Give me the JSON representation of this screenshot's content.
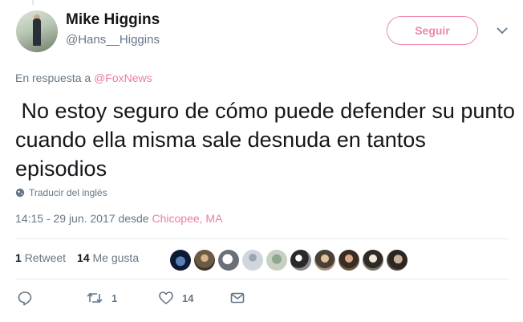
{
  "author": {
    "name": "Mike Higgins",
    "handle": "@Hans__Higgins"
  },
  "follow_button": "Seguir",
  "reply_to": {
    "prefix": "En respuesta a",
    "mention": "@FoxNews"
  },
  "tweet_text": " No estoy seguro de cómo puede defender su punto cuando ella misma sale desnuda en tantos episodios",
  "translate_label": "Traducir del inglés",
  "meta": {
    "time": "14:15 - 29 jun. 2017",
    "desde": "desde",
    "place": "Chicopee, MA"
  },
  "stats": {
    "retweets_count": "1",
    "retweets_label": "Retweet",
    "likes_count": "14",
    "likes_label": "Me gusta"
  },
  "actions": {
    "retweet_count": "1",
    "like_count": "14"
  },
  "icons": [
    "reply-icon",
    "retweet-icon",
    "heart-icon",
    "envelope-icon",
    "globe-icon",
    "chevron-down-icon"
  ],
  "colors": {
    "accent": "#e0245e",
    "secondary_text": "#657786",
    "primary_text": "#14171a"
  }
}
